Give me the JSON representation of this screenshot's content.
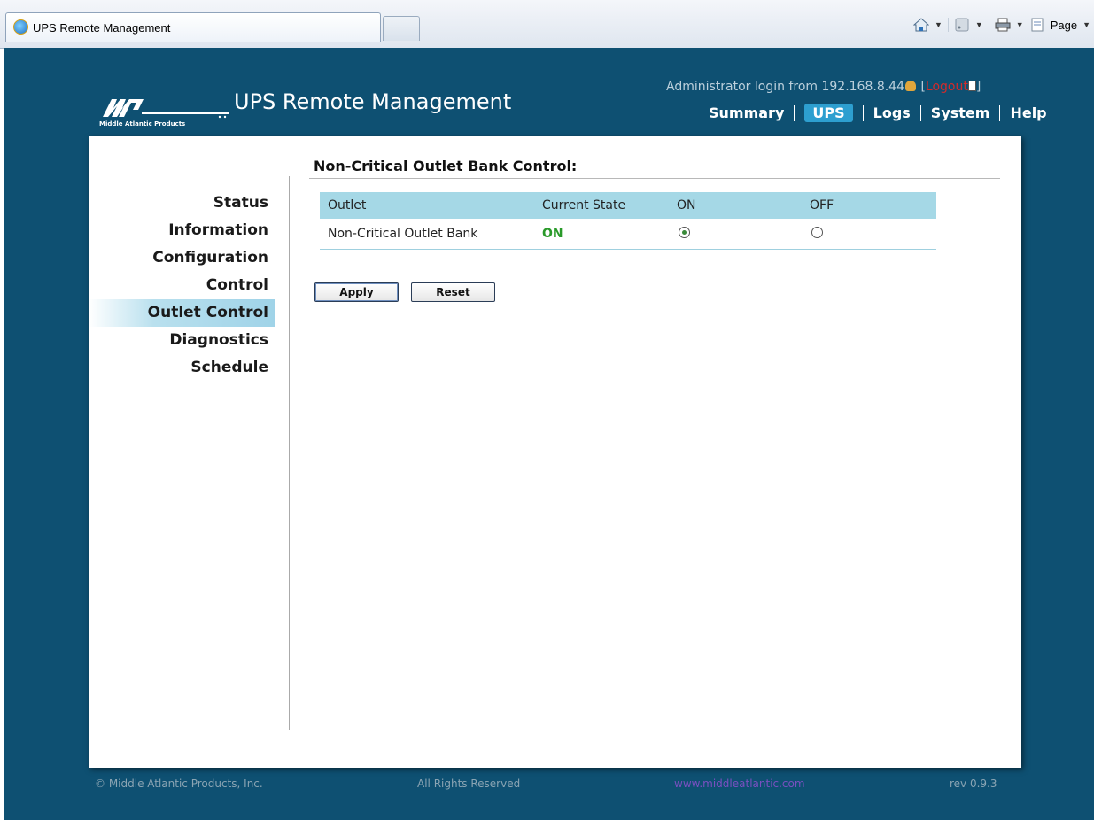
{
  "browser": {
    "tab_title": "UPS Remote Management",
    "page_menu_label": "Page"
  },
  "header": {
    "app_title": "UPS Remote Management",
    "logo_tagline": "Middle Atlantic Products",
    "admin_text": "Administrator login from 192.168.8.44",
    "logout_label": "Logout",
    "nav": [
      "Summary",
      "UPS",
      "Logs",
      "System",
      "Help"
    ],
    "active_nav": "UPS"
  },
  "sidebar": {
    "items": [
      "Status",
      "Information",
      "Configuration",
      "Control",
      "Outlet Control",
      "Diagnostics",
      "Schedule"
    ],
    "active": "Outlet Control"
  },
  "main": {
    "section_title": "Non-Critical Outlet Bank Control:",
    "table": {
      "headers": [
        "Outlet",
        "Current State",
        "ON",
        "OFF"
      ],
      "rows": [
        {
          "outlet": "Non-Critical Outlet Bank",
          "state": "ON",
          "selected": "ON"
        }
      ]
    },
    "apply_label": "Apply",
    "reset_label": "Reset"
  },
  "footer": {
    "copyright": "© Middle Atlantic Products, Inc.",
    "rights": "All Rights Reserved",
    "link": "www.middleatlantic.com",
    "version": "rev 0.9.3"
  },
  "colors": {
    "page_bg": "#0e5072",
    "table_header": "#a5d8e6",
    "nav_active": "#2d9fd0",
    "state_on": "#2a9a2a",
    "logout": "#d22b2b"
  }
}
